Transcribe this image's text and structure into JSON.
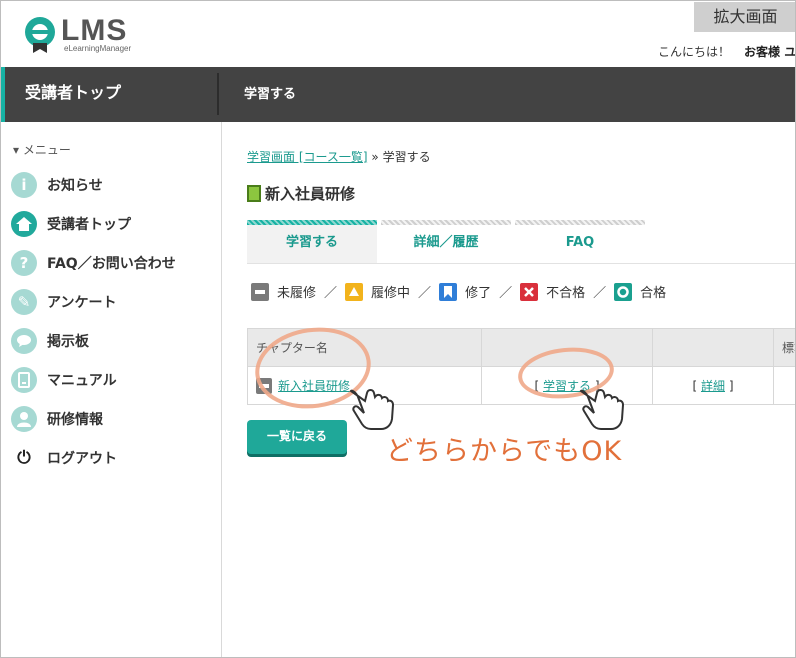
{
  "header": {
    "logo_text": "LMS",
    "logo_sub": "eLearningManager",
    "zoom_button": "拡大画面",
    "greeting": "こんにちは！",
    "user_name": "お客様 ユーザ"
  },
  "navbar": {
    "title": "受講者トップ",
    "item": "学習する"
  },
  "sidebar": {
    "menu_label": "▾ メニュー",
    "items": [
      {
        "label": "お知らせ",
        "icon": "info-icon"
      },
      {
        "label": "受講者トップ",
        "icon": "home-icon"
      },
      {
        "label": "FAQ／お問い合わせ",
        "icon": "question-icon"
      },
      {
        "label": "アンケート",
        "icon": "pencil-icon"
      },
      {
        "label": "掲示板",
        "icon": "chat-icon"
      },
      {
        "label": "マニュアル",
        "icon": "manual-icon"
      },
      {
        "label": "研修情報",
        "icon": "user-icon"
      },
      {
        "label": "ログアウト",
        "icon": "power-icon"
      }
    ]
  },
  "breadcrumb": {
    "link": "学習画面 [コース一覧]",
    "sep": " » ",
    "current": "学習する"
  },
  "course": {
    "title": "新入社員研修"
  },
  "tabs": [
    {
      "label": "学習する",
      "active": true
    },
    {
      "label": "詳細／履歴",
      "active": false
    },
    {
      "label": "FAQ",
      "active": false
    }
  ],
  "legend": [
    {
      "label": "未履修",
      "color": "#7a7a7a"
    },
    {
      "label": "履修中",
      "color": "#f2b31c"
    },
    {
      "label": "修了",
      "color": "#2f7ed8"
    },
    {
      "label": "不合格",
      "color": "#d9303c"
    },
    {
      "label": "合格",
      "color": "#1aa08f"
    }
  ],
  "legend_sep": "／",
  "table": {
    "headers": [
      "チャプター名",
      "",
      "",
      "標準"
    ],
    "row": {
      "chapter": "新入社員研修",
      "study_open": "[ ",
      "study_link": "学習する",
      "study_close": " ]",
      "detail_open": "[ ",
      "detail_link": "詳細",
      "detail_close": " ]"
    }
  },
  "back_button": "一覧に戻る",
  "annotation": "どちらからでもOK",
  "colors": {
    "accent": "#17b2a4",
    "annotation": "#e2703a",
    "navbar": "#434343"
  }
}
